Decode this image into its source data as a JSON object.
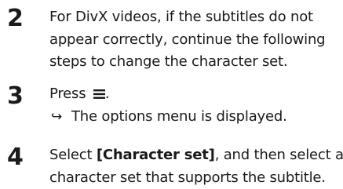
{
  "steps": [
    {
      "number": "2",
      "lines": [
        "For DivX videos, if the subtitles do not",
        "appear correctly, continue the following",
        "steps to change the character set."
      ]
    },
    {
      "number": "3",
      "press_label": "Press",
      "icon": "menu-options-icon",
      "press_suffix": ".",
      "result_arrow": "↪",
      "result_text": "The options menu is displayed."
    },
    {
      "number": "4",
      "select_label": "Select",
      "option": "[Character set]",
      "line1_suffix": ", and then select a",
      "line2": "character set that supports the subtitle."
    }
  ]
}
